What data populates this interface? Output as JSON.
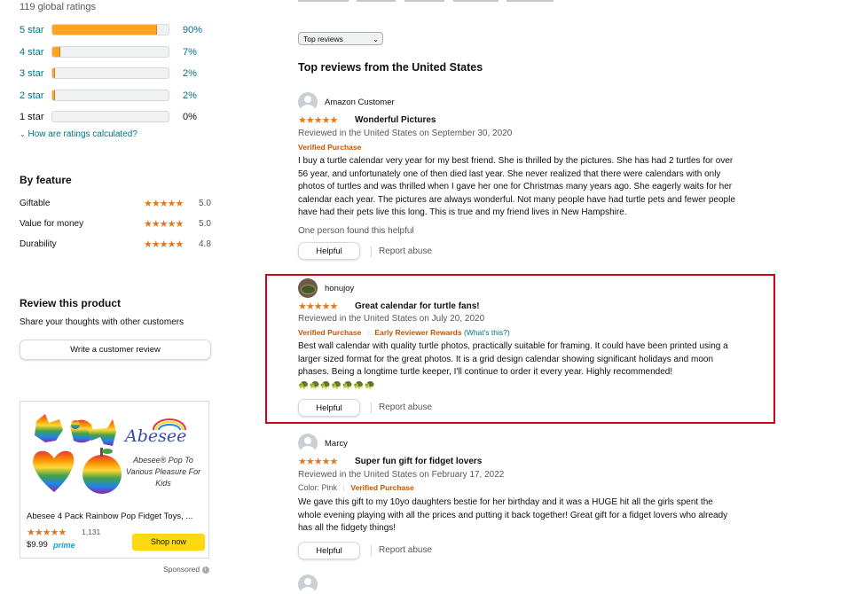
{
  "histogram": {
    "global_ratings": "119 global ratings",
    "rows": [
      {
        "label": "5 star",
        "pct": "90%",
        "fill": 0.9
      },
      {
        "label": "4 star",
        "pct": "7%",
        "fill": 0.07
      },
      {
        "label": "3 star",
        "pct": "2%",
        "fill": 0.02
      },
      {
        "label": "2 star",
        "pct": "2%",
        "fill": 0.02
      },
      {
        "label": "1 star",
        "pct": "0%",
        "fill": 0.0
      }
    ],
    "how_calculated": "How are ratings calculated?"
  },
  "by_feature": {
    "title": "By feature",
    "items": [
      {
        "name": "Giftable",
        "score": "5.0",
        "stars": "★★★★★"
      },
      {
        "name": "Value for money",
        "score": "5.0",
        "stars": "★★★★★"
      },
      {
        "name": "Durability",
        "score": "4.8",
        "stars": "★★★★★"
      }
    ]
  },
  "review_product": {
    "title": "Review this product",
    "subtitle": "Share your thoughts with other customers",
    "button": "Write a customer review"
  },
  "ad": {
    "brand": "Abesee",
    "tagline": "Abesee® Pop To Various Pleasure For Kids",
    "title": "Abesee 4 Pack Rainbow Pop Fidget Toys, ...",
    "stars": "★★★★★",
    "rating_count": "1,131",
    "price": "$9.99",
    "prime": "prime",
    "shop_button": "Shop now",
    "sponsored": "Sponsored"
  },
  "sort": {
    "selected": "Top reviews"
  },
  "reviews_header": "Top reviews from the United States",
  "reviews": [
    {
      "name": "Amazon Customer",
      "stars": "★★★★★",
      "title": "Wonderful Pictures",
      "meta": "Reviewed in the United States on September 30, 2020",
      "verified": "Verified Purchase",
      "body": "I buy a turtle calendar very year for my best friend. She is thrilled by the pictures. She has had 2 turtles for over 56 year, and unfortunately one of then died last year. She never realized that there were calendars with only photos of turtles and was thrilled when I gave her one for Christmas many years ago. She eagerly waits for her calendar each year. The pictures are always wonderful. Not many people have had turtle pets and fewer people have had their pets live this long. This is true and my friend lives in New Hampshire.",
      "helpful_text": "One person found this helpful",
      "helpful_button": "Helpful",
      "report": "Report abuse"
    },
    {
      "name": "honujoy",
      "stars": "★★★★★",
      "title": "Great calendar for turtle fans!",
      "meta": "Reviewed in the United States on July 20, 2020",
      "verified": "Verified Purchase",
      "early_reviewer": "Early Reviewer Rewards",
      "whats_this": "(What's this?)",
      "body": "Best wall calendar with quality turtle photos, practically suitable for framing. It could have been printed using a larger sized format for the great photos. It is a grid design calendar showing significant holidays and moon phases. Being a longtime turtle keeper, I'll continue to order it every year. Highly recommended!",
      "emoji": "🐢🐢🐢🐢🐢🐢🐢",
      "helpful_button": "Helpful",
      "report": "Report abuse"
    },
    {
      "name": "Marcy",
      "stars": "★★★★★",
      "title": "Super fun gift for fidget lovers",
      "meta": "Reviewed in the United States on February 17, 2022",
      "color": "Color: Pink",
      "verified": "Verified Purchase",
      "body": "We gave this gift to my 10yo daughters bestie for her birthday and it was a HUGE hit all the girls spent the whole evening playing with all the prices and putting it back together! Great gift for a fidget lovers who already has all the fidgety things!",
      "helpful_button": "Helpful",
      "report": "Report abuse"
    }
  ]
}
